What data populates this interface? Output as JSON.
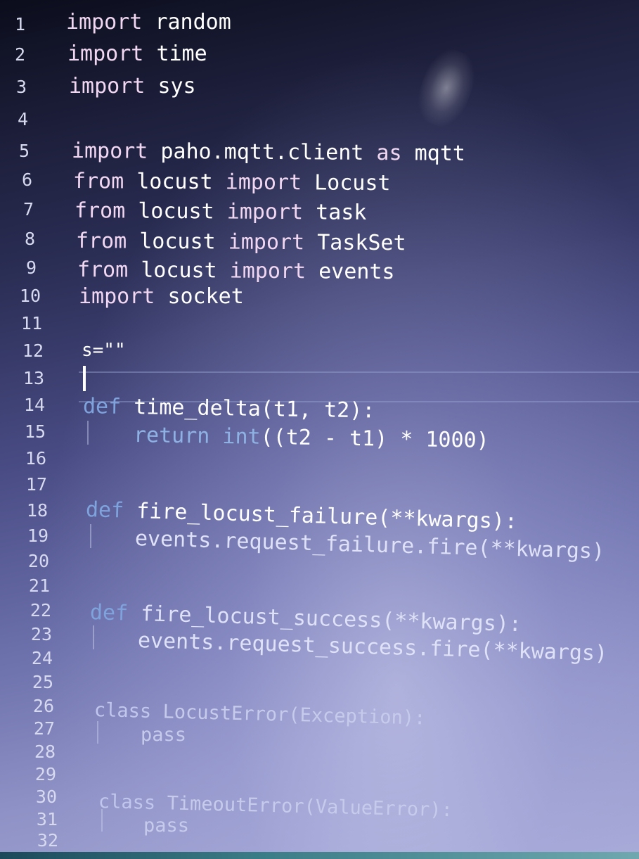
{
  "editor": {
    "line_numbers": [
      "1",
      "2",
      "3",
      "4",
      "5",
      "6",
      "7",
      "8",
      "9",
      "10",
      "11",
      "12",
      "13",
      "14",
      "15",
      "16",
      "17",
      "18",
      "19",
      "20",
      "21",
      "22",
      "23",
      "24",
      "25",
      "26",
      "27",
      "28",
      "29",
      "30",
      "31",
      "32"
    ],
    "tokens": {
      "l1_kw": "import",
      "l1_id": "random",
      "l2_kw": "import",
      "l2_id": "time",
      "l3_kw": "import",
      "l3_id": "sys",
      "l5_kw": "import",
      "l5_mod": "paho.mqtt.client",
      "l5_as": "as",
      "l5_alias": "mqtt",
      "l6_from": "from",
      "l6_mod": "locust",
      "l6_imp": "import",
      "l6_name": "Locust",
      "l7_from": "from",
      "l7_mod": "locust",
      "l7_imp": "import",
      "l7_name": "task",
      "l8_from": "from",
      "l8_mod": "locust",
      "l8_imp": "import",
      "l8_name": "TaskSet",
      "l9_from": "from",
      "l9_mod": "locust",
      "l9_imp": "import",
      "l9_name": "events",
      "l10_kw": "import",
      "l10_id": "socket",
      "l12_code": "s=\"\"",
      "l14_def": "def",
      "l14_sig": "time_delta(t1, t2):",
      "l15_ret": "return",
      "l15_int": "int",
      "l15_rest": "((t2 - t1) * 1000)",
      "l18_def": "def",
      "l18_sig": "fire_locust_failure(**kwargs):",
      "l19_body": "events.request_failure.fire(**kwargs)",
      "l22_def": "def",
      "l22_sig": "fire_locust_success(**kwargs):",
      "l23_body": "events.request_success.fire(**kwargs)",
      "l26_class": "class",
      "l26_sig": "LocustError(Exception):",
      "l27_body": "pass",
      "l30_class": "class",
      "l30_sig": "TimeoutError(ValueError):",
      "l31_body": "pass"
    }
  },
  "colors": {
    "keyword_import": "#f1d7f1",
    "keyword_def": "#7fa3dc",
    "identifier": "#ffffff",
    "builtin": "#8fb2e4"
  }
}
